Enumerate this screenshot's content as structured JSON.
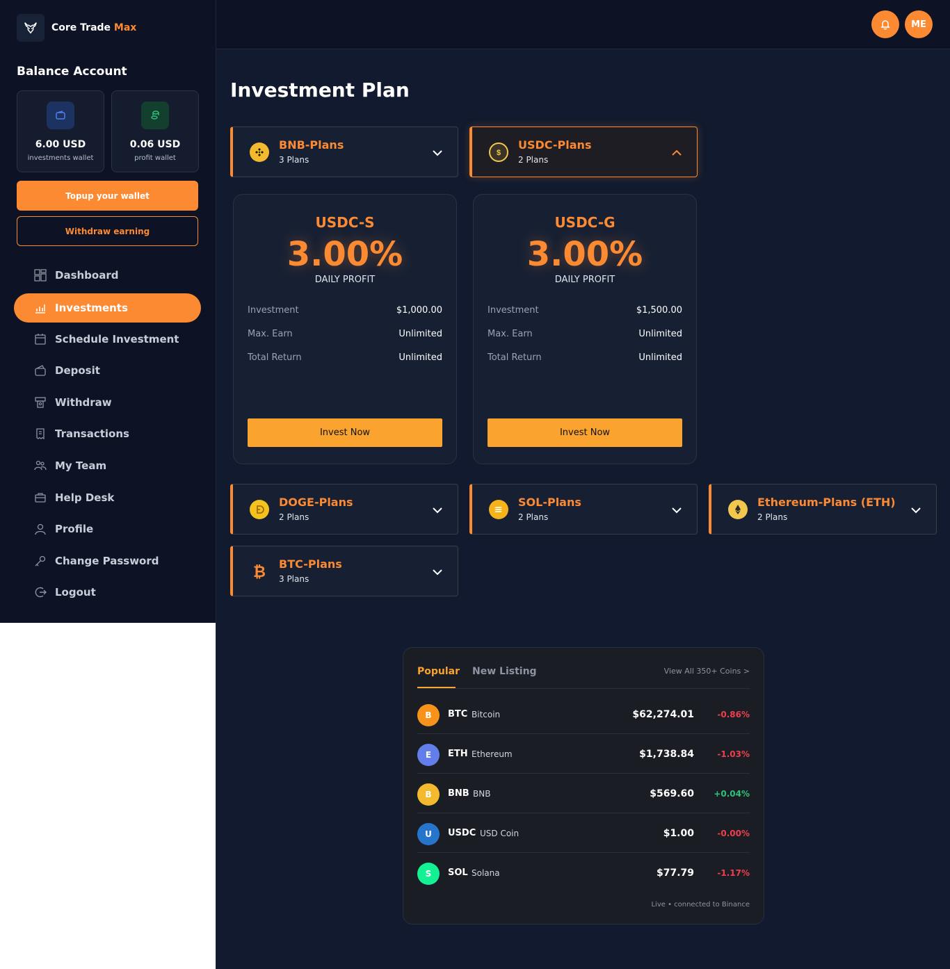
{
  "brand": {
    "name": "Core Trade ",
    "accent": "Max"
  },
  "sidebar": {
    "title": "Balance Account",
    "wallets": [
      {
        "amount": "6.00 USD",
        "label": "investments wallet"
      },
      {
        "amount": "0.06 USD",
        "label": "profit wallet"
      }
    ],
    "topup_label": "Topup your wallet",
    "withdraw_label": "Withdraw earning",
    "nav": [
      {
        "label": "Dashboard"
      },
      {
        "label": "Investments"
      },
      {
        "label": "Schedule Investment"
      },
      {
        "label": "Deposit"
      },
      {
        "label": "Withdraw"
      },
      {
        "label": "Transactions"
      },
      {
        "label": "My Team"
      },
      {
        "label": "Help Desk"
      },
      {
        "label": "Profile"
      },
      {
        "label": "Change Password"
      },
      {
        "label": "Logout"
      }
    ]
  },
  "header": {
    "avatar": "ME"
  },
  "page": {
    "title": "Investment Plan"
  },
  "plan_groups": [
    {
      "name": "BNB-Plans",
      "count": "3 Plans"
    },
    {
      "name": "USDC-Plans",
      "count": "2 Plans"
    },
    {
      "name": "DOGE-Plans",
      "count": "2 Plans"
    },
    {
      "name": "SOL-Plans",
      "count": "2 Plans"
    },
    {
      "name": "Ethereum-Plans (ETH)",
      "count": "2 Plans"
    },
    {
      "name": "BTC-Plans",
      "count": "3 Plans"
    }
  ],
  "plans": [
    {
      "name": "USDC-S",
      "rate": "3.00%",
      "rate_label": "DAILY PROFIT",
      "rows": [
        {
          "k": "Investment",
          "v": "$1,000.00"
        },
        {
          "k": "Max. Earn",
          "v": "Unlimited"
        },
        {
          "k": "Total Return",
          "v": "Unlimited"
        }
      ],
      "cta": "Invest Now"
    },
    {
      "name": "USDC-G",
      "rate": "3.00%",
      "rate_label": "DAILY PROFIT",
      "rows": [
        {
          "k": "Investment",
          "v": "$1,500.00"
        },
        {
          "k": "Max. Earn",
          "v": "Unlimited"
        },
        {
          "k": "Total Return",
          "v": "Unlimited"
        }
      ],
      "cta": "Invest Now"
    }
  ],
  "market": {
    "tabs": [
      "Popular",
      "New Listing"
    ],
    "view_all": "View All 350+ Coins >",
    "coins": [
      {
        "letter": "B",
        "symbol": "BTC",
        "name": "Bitcoin",
        "price": "$62,274.01",
        "change": "-0.86%"
      },
      {
        "letter": "E",
        "symbol": "ETH",
        "name": "Ethereum",
        "price": "$1,738.84",
        "change": "-1.03%"
      },
      {
        "letter": "B",
        "symbol": "BNB",
        "name": "BNB",
        "price": "$569.60",
        "change": "+0.04%"
      },
      {
        "letter": "U",
        "symbol": "USDC",
        "name": "USD Coin",
        "price": "$1.00",
        "change": "-0.00%"
      },
      {
        "letter": "S",
        "symbol": "SOL",
        "name": "Solana",
        "price": "$77.79",
        "change": "-1.17%"
      }
    ],
    "status": "Live • connected to Binance"
  },
  "colors": {
    "accent": "#fb8a33",
    "negative": "#ef3f4f",
    "positive": "#2ec27a"
  }
}
